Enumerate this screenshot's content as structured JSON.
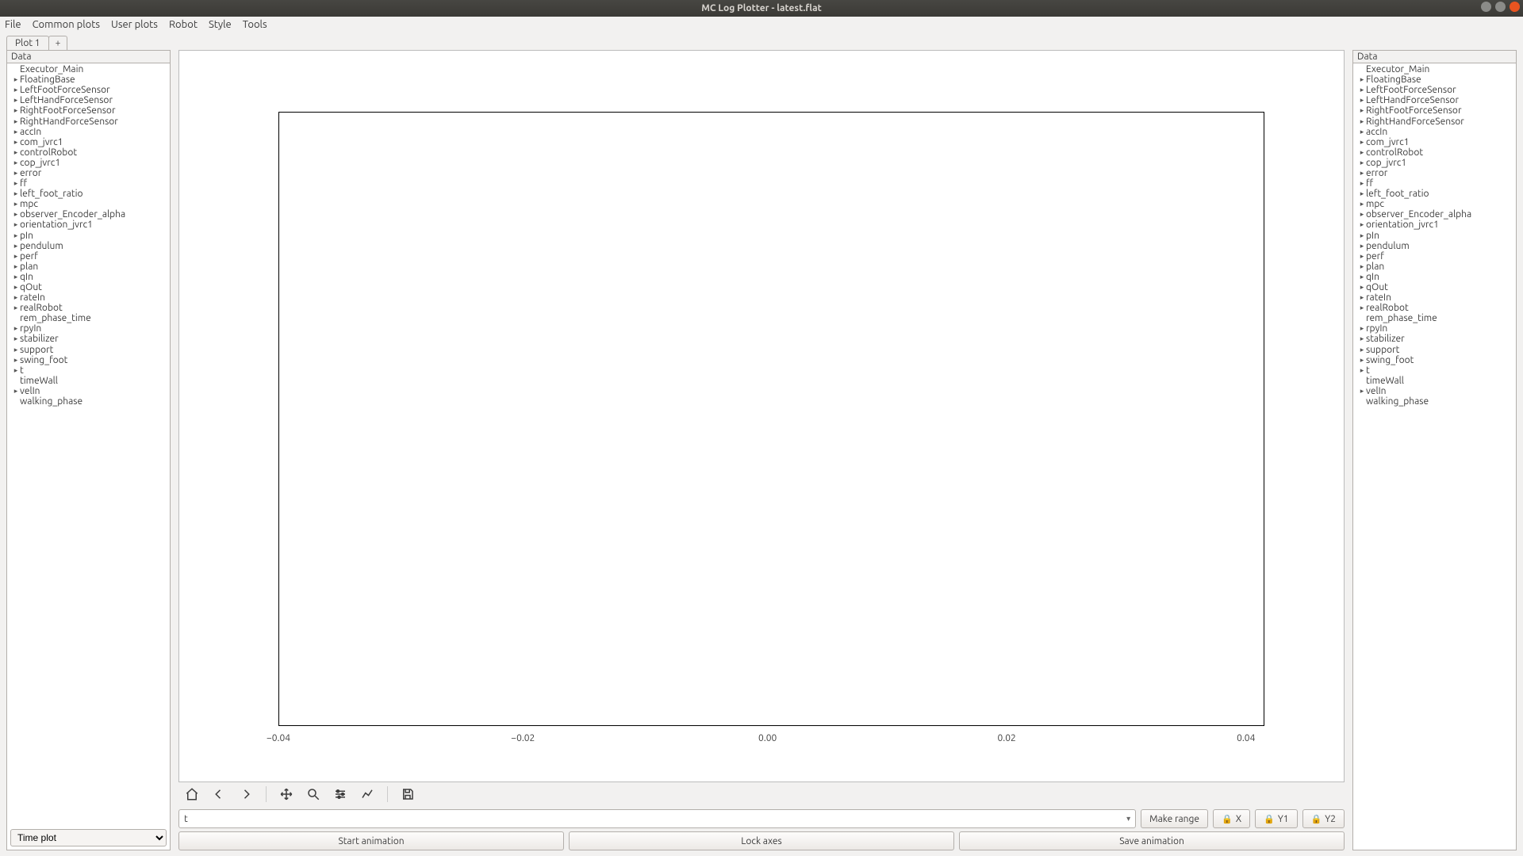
{
  "title": "MC Log Plotter - latest.flat",
  "menubar": [
    "File",
    "Common plots",
    "User plots",
    "Robot",
    "Style",
    "Tools"
  ],
  "tabs": [
    {
      "label": "Plot 1"
    }
  ],
  "panel_header": "Data",
  "tree_items": [
    {
      "label": "Executor_Main",
      "expandable": false
    },
    {
      "label": "FloatingBase",
      "expandable": true
    },
    {
      "label": "LeftFootForceSensor",
      "expandable": true
    },
    {
      "label": "LeftHandForceSensor",
      "expandable": true
    },
    {
      "label": "RightFootForceSensor",
      "expandable": true
    },
    {
      "label": "RightHandForceSensor",
      "expandable": true
    },
    {
      "label": "accIn",
      "expandable": true
    },
    {
      "label": "com_jvrc1",
      "expandable": true
    },
    {
      "label": "controlRobot",
      "expandable": true
    },
    {
      "label": "cop_jvrc1",
      "expandable": true
    },
    {
      "label": "error",
      "expandable": true
    },
    {
      "label": "ff",
      "expandable": true
    },
    {
      "label": "left_foot_ratio",
      "expandable": true
    },
    {
      "label": "mpc",
      "expandable": true
    },
    {
      "label": "observer_Encoder_alpha",
      "expandable": true
    },
    {
      "label": "orientation_jvrc1",
      "expandable": true
    },
    {
      "label": "pIn",
      "expandable": true
    },
    {
      "label": "pendulum",
      "expandable": true
    },
    {
      "label": "perf",
      "expandable": true
    },
    {
      "label": "plan",
      "expandable": true
    },
    {
      "label": "qIn",
      "expandable": true
    },
    {
      "label": "qOut",
      "expandable": true
    },
    {
      "label": "rateIn",
      "expandable": true
    },
    {
      "label": "realRobot",
      "expandable": true
    },
    {
      "label": "rem_phase_time",
      "expandable": false
    },
    {
      "label": "rpyIn",
      "expandable": true
    },
    {
      "label": "stabilizer",
      "expandable": true
    },
    {
      "label": "support",
      "expandable": true
    },
    {
      "label": "swing_foot",
      "expandable": true
    },
    {
      "label": "t",
      "expandable": true
    },
    {
      "label": "timeWall",
      "expandable": false
    },
    {
      "label": "velIn",
      "expandable": true
    },
    {
      "label": "walking_phase",
      "expandable": false
    }
  ],
  "chart_data": {
    "type": "line",
    "series": [],
    "xticks": [
      "−0.04",
      "−0.02",
      "0.00",
      "0.02",
      "0.04"
    ],
    "xlim": [
      -0.05,
      0.05
    ]
  },
  "xaxis_combo_value": "t",
  "buttons": {
    "make_range": "Make range",
    "lock_x": "X",
    "lock_y1": "Y1",
    "lock_y2": "Y2",
    "start_anim": "Start animation",
    "lock_axes": "Lock axes",
    "save_anim": "Save animation"
  },
  "plot_type_selector": "Time plot"
}
